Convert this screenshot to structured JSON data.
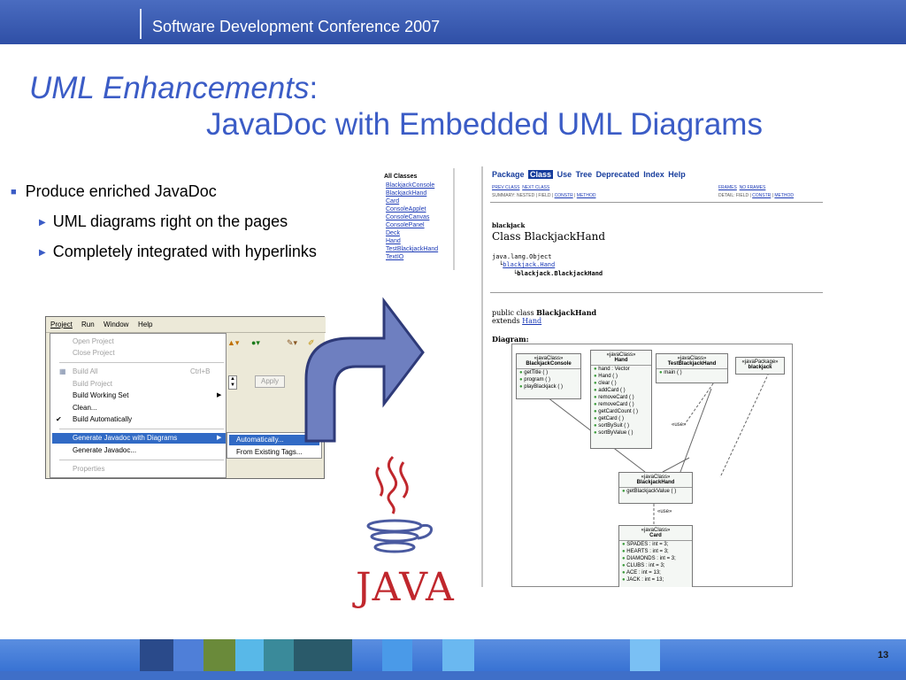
{
  "header": {
    "conference": "Software Development Conference 2007"
  },
  "title": {
    "line1_italic": "UML Enhancements",
    "line1_colon": ":",
    "line2": "JavaDoc with Embedded UML Diagrams"
  },
  "bullets": [
    {
      "text": "Produce enriched JavaDoc",
      "icon": "square-bullet-icon"
    },
    {
      "text": "UML diagrams right on the pages",
      "icon": "triangle-bullet-icon"
    },
    {
      "text": "Completely integrated with hyperlinks",
      "icon": "triangle-bullet-icon"
    }
  ],
  "all_classes": {
    "heading": "All Classes",
    "items": [
      "BlackjackConsole",
      "BlackjackHand",
      "Card",
      "ConsoleApplet",
      "ConsoleCanvas",
      "ConsolePanel",
      "Deck",
      "Hand",
      "TestBlackjackHand",
      "TextIO"
    ]
  },
  "javadoc": {
    "nav": [
      "Package",
      "Class",
      "Use",
      "Tree",
      "Deprecated",
      "Index",
      "Help"
    ],
    "prev_class": "PREV CLASS",
    "next_class": "NEXT CLASS",
    "frames": "FRAMES",
    "no_frames": "NO FRAMES",
    "summary": "SUMMARY: NESTED | FIELD |",
    "summary_constr": "CONSTR",
    "summary_method": "METHOD",
    "detail": "DETAIL: FIELD |",
    "detail_constr": "CONSTR",
    "detail_method": "METHOD",
    "package": "blackjack",
    "class_title": "Class BlackjackHand",
    "hier1": "java.lang.Object",
    "hier2": "blackjack.Hand",
    "hier3": "blackjack.BlackjackHand",
    "decl1_pre": "public class ",
    "decl1_name": "BlackjackHand",
    "decl2_pre": "extends ",
    "decl2_link": "Hand",
    "diagram_label": "Diagram:",
    "uml": {
      "stereo_class": "«javaClass»",
      "stereo_package": "«javaPackage»",
      "boxes": {
        "console": {
          "name": "BlackjackConsole",
          "rows": [
            "getTitle ( )",
            "program ( )",
            "playBlackjack ( )"
          ]
        },
        "hand": {
          "name": "Hand",
          "rows": [
            "hand : Vector",
            "Hand ( )",
            "clear ( )",
            "addCard ( )",
            "removeCard ( )",
            "removeCard ( )",
            "getCardCount ( )",
            "getCard ( )",
            "sortBySuit ( )",
            "sortByValue ( )"
          ]
        },
        "test": {
          "name": "TestBlackjackHand",
          "rows": [
            "main ( )"
          ]
        },
        "pkg": {
          "name": "blackjack"
        },
        "bjhand": {
          "name": "BlackjackHand",
          "rows": [
            "getBlackjackValue ( )"
          ]
        },
        "card": {
          "name": "Card",
          "rows": [
            "SPADES : int = 3;",
            "HEARTS : int = 3;",
            "DIAMONDS : int = 3;",
            "CLUBS : int = 3;",
            "ACE : int = 13;",
            "JACK : int = 13;"
          ]
        }
      },
      "use_label": "«use»"
    }
  },
  "eclipse": {
    "menus": [
      "Project",
      "Run",
      "Window",
      "Help"
    ],
    "items": [
      {
        "label": "Open Project",
        "disabled": true
      },
      {
        "label": "Close Project",
        "disabled": true
      },
      {
        "label": "Build All",
        "shortcut": "Ctrl+B",
        "disabled": true
      },
      {
        "label": "Build Project",
        "disabled": true
      },
      {
        "label": "Build Working Set",
        "disabled": false
      },
      {
        "label": "Clean...",
        "disabled": false
      },
      {
        "label": "Build Automatically",
        "disabled": false
      },
      {
        "label": "Generate Javadoc with Diagrams",
        "disabled": false
      },
      {
        "label": "Generate Javadoc...",
        "disabled": false
      },
      {
        "label": "Properties",
        "disabled": true
      }
    ],
    "submenu": [
      "Automatically...",
      "From Existing Tags..."
    ],
    "apply": "Apply"
  },
  "java_logo": {
    "word": "JAVA"
  },
  "footer": {
    "page_number": "13"
  },
  "colors": {
    "accent": "#3b5cc6",
    "bar": "#2f4fa6",
    "highlight": "#316ac5",
    "java_red": "#c0272d"
  }
}
